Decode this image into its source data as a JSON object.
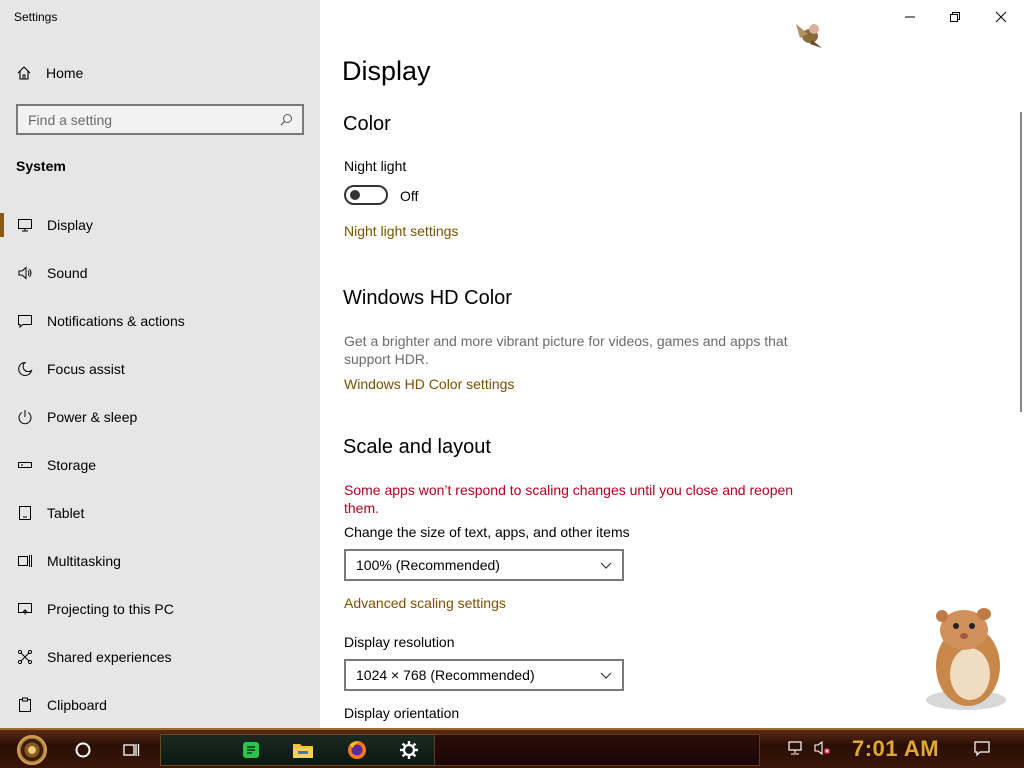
{
  "window": {
    "title": "Settings",
    "controls": [
      "minimize",
      "restore",
      "close"
    ]
  },
  "sidebar": {
    "home_label": "Home",
    "search_placeholder": "Find a setting",
    "section_title": "System",
    "items": [
      {
        "label": "Display",
        "icon": "monitor-icon",
        "active": true
      },
      {
        "label": "Sound",
        "icon": "speaker-icon"
      },
      {
        "label": "Notifications & actions",
        "icon": "notification-icon"
      },
      {
        "label": "Focus assist",
        "icon": "moon-icon"
      },
      {
        "label": "Power & sleep",
        "icon": "power-icon"
      },
      {
        "label": "Storage",
        "icon": "storage-icon"
      },
      {
        "label": "Tablet",
        "icon": "tablet-icon"
      },
      {
        "label": "Multitasking",
        "icon": "multitasking-icon"
      },
      {
        "label": "Projecting to this PC",
        "icon": "projecting-icon"
      },
      {
        "label": "Shared experiences",
        "icon": "shared-icon"
      },
      {
        "label": "Clipboard",
        "icon": "clipboard-icon"
      }
    ]
  },
  "main": {
    "page_title": "Display",
    "color": {
      "heading": "Color",
      "night_light_label": "Night light",
      "night_light_state": "Off",
      "night_light_on": false,
      "night_light_link": "Night light settings"
    },
    "hd_color": {
      "heading": "Windows HD Color",
      "description": "Get a brighter and more vibrant picture for videos, games and apps that support HDR.",
      "link": "Windows HD Color settings"
    },
    "scale": {
      "heading": "Scale and layout",
      "warning": "Some apps won’t respond to scaling changes until you close and reopen them.",
      "size_label": "Change the size of text, apps, and other items",
      "size_value": "100% (Recommended)",
      "advanced_link": "Advanced scaling settings",
      "resolution_label": "Display resolution",
      "resolution_value": "1024 × 768 (Recommended)",
      "orientation_label": "Display orientation"
    }
  },
  "taskbar": {
    "clock": "7:01 AM",
    "apps": [
      "cortana-icon",
      "task-view-icon",
      "notes-app-icon",
      "file-explorer-icon",
      "firefox-icon",
      "settings-icon"
    ]
  },
  "colors": {
    "accent": "#7a5100",
    "warning": "#b4001f",
    "sidebar_bg": "#e6e6e6",
    "clock": "#e0a830"
  }
}
